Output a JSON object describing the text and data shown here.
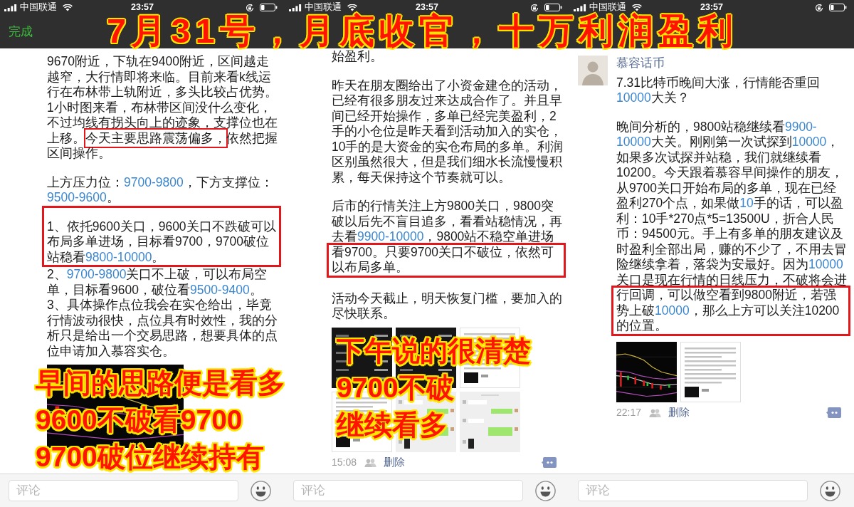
{
  "caption": "7月31号，月底收官，十万利润盈利",
  "panels": [
    {
      "status_bar": {
        "carrier": "中国联通",
        "time": "23:57"
      },
      "nav_bar": {
        "done": "完成"
      },
      "post": {
        "sections": [
          {
            "paragraphs": [
              {
                "boxed": false,
                "parts": [
                  {
                    "kind": "plain",
                    "text": "9670附近，下轨在9400附近，区间越走越窄，大行情即将来临。目前来看k线运行在布林带上轨附近，多头比较占优势。1小时图来看，布林带区间没什么变化，不过均线有拐头向上的迹象，支撑位也在上移。"
                  },
                  {
                    "kind": "marked",
                    "text": "今天主要思路震荡偏多，"
                  },
                  {
                    "kind": "plain",
                    "text": "依然把握区间操作。"
                  }
                ]
              }
            ]
          },
          {
            "paragraphs": [
              {
                "boxed": false,
                "parts": [
                  {
                    "kind": "plain",
                    "text": "上方压力位："
                  },
                  {
                    "kind": "number",
                    "text": "9700-9800"
                  },
                  {
                    "kind": "plain",
                    "text": "，下方支撑位："
                  },
                  {
                    "kind": "number",
                    "text": "9500-9600"
                  },
                  {
                    "kind": "plain",
                    "text": "。"
                  }
                ]
              }
            ]
          },
          {
            "paragraphs": [
              {
                "boxed": true,
                "parts": [
                  {
                    "kind": "plain",
                    "text": "1、依托9600关口，9600关口不跌破可以布局多单进场，目标看9700，9700破位站稳看"
                  },
                  {
                    "kind": "number",
                    "text": "9800-10000"
                  },
                  {
                    "kind": "plain",
                    "text": "。"
                  }
                ]
              },
              {
                "boxed": false,
                "parts": [
                  {
                    "kind": "plain",
                    "text": "2、"
                  },
                  {
                    "kind": "number",
                    "text": "9700-9800"
                  },
                  {
                    "kind": "plain",
                    "text": "关口不上破，可以布局空单，目标看9600，破位看"
                  },
                  {
                    "kind": "number",
                    "text": "9500-9400"
                  },
                  {
                    "kind": "plain",
                    "text": "。"
                  }
                ]
              },
              {
                "boxed": false,
                "parts": [
                  {
                    "kind": "plain",
                    "text": "3、具体操作点位我会在实仓给出，毕竟行情波动很快，点位具有时效性，我的分析只是给出一个交易思路，想要具体的点位申请加入慕容实仓。"
                  }
                ]
              }
            ]
          }
        ],
        "images": [
          {
            "kind": "chart"
          }
        ]
      },
      "overlay_caption": [
        "早间的思路便是看多",
        "9600不破看9700",
        "9700破位继续持有"
      ],
      "comment_bar": {
        "placeholder": "评论"
      }
    },
    {
      "status_bar": {
        "carrier": "中国联通",
        "time": "23:57"
      },
      "post": {
        "sections": [
          {
            "paragraphs": [
              {
                "boxed": false,
                "parts": [
                  {
                    "kind": "plain",
                    "text": "始盈利。"
                  }
                ]
              }
            ]
          },
          {
            "paragraphs": [
              {
                "boxed": false,
                "parts": [
                  {
                    "kind": "plain",
                    "text": "昨天在朋友圈给出了小资金建仓的活动，已经有很多朋友过来达成合作了。并且早间已经开始操作，多单已经完美盈利，2手的小仓位是昨天看到活动加入的实仓，10手的是大资金的实仓布局的多单。利润区别虽然很大，但是我们细水长流慢慢积累，每天保持这个节奏就可以。"
                  }
                ]
              }
            ]
          },
          {
            "paragraphs": [
              {
                "boxed": false,
                "parts": [
                  {
                    "kind": "plain",
                    "text": "后市的行情关注上方9800关口，9800突破以后先不盲目追多，看看站稳情况，再去看"
                  },
                  {
                    "kind": "number",
                    "text": "9900-10000"
                  },
                  {
                    "kind": "plain",
                    "text": "，9800站不稳空单进场"
                  }
                ]
              },
              {
                "boxed": true,
                "parts": [
                  {
                    "kind": "plain",
                    "text": "看9700。只要9700关口不破位，依然可以布局多单。"
                  }
                ]
              }
            ]
          },
          {
            "paragraphs": [
              {
                "boxed": false,
                "parts": [
                  {
                    "kind": "plain",
                    "text": "活动今天截止，明天恢复门槛，要加入的尽快联系。"
                  }
                ]
              }
            ]
          }
        ],
        "images": [
          {
            "kind": "dark"
          },
          {
            "kind": "dark"
          },
          {
            "kind": "text"
          },
          {
            "kind": "text"
          },
          {
            "kind": "chat"
          },
          {
            "kind": "chat"
          }
        ],
        "footer": {
          "time": "15:08",
          "delete": "删除"
        }
      },
      "overlay_caption": [
        "下午说的很清楚",
        "9700不破",
        "继续看多"
      ],
      "comment_bar": {
        "placeholder": "评论"
      }
    },
    {
      "status_bar": {
        "carrier": "中国联通",
        "time": "23:57"
      },
      "post": {
        "author": {
          "name": "慕容话币"
        },
        "sections": [
          {
            "paragraphs": [
              {
                "boxed": false,
                "parts": [
                  {
                    "kind": "plain",
                    "text": "7.31比特币晚间大涨，行情能否重回"
                  },
                  {
                    "kind": "number",
                    "text": "10000"
                  },
                  {
                    "kind": "plain",
                    "text": "大关？"
                  }
                ]
              }
            ]
          },
          {
            "paragraphs": [
              {
                "boxed": false,
                "parts": [
                  {
                    "kind": "plain",
                    "text": "晚间分析的，9800站稳继续看"
                  },
                  {
                    "kind": "number",
                    "text": "9900-10000"
                  },
                  {
                    "kind": "plain",
                    "text": "大关。刚刚第一次试探到"
                  },
                  {
                    "kind": "number",
                    "text": "10000"
                  },
                  {
                    "kind": "plain",
                    "text": "，如果多次试探并站稳，我们就继续看10200。今天跟着慕容早间操作的朋友，从9700关口开始布局的多单，现在已经盈利270个点，如果做"
                  },
                  {
                    "kind": "number",
                    "text": "10"
                  },
                  {
                    "kind": "plain",
                    "text": "手的话，可以盈利：10手*270点*5=13500U，折合人民币：94500元。手上有多单的朋友建议及时盈利全部出局，赚的不少了，不用去冒险继续拿着，落袋为安最好。因为"
                  },
                  {
                    "kind": "number",
                    "text": "10000"
                  },
                  {
                    "kind": "plain",
                    "text": "关口是现在行情的日线压力，不破将会进"
                  }
                ]
              },
              {
                "boxed": true,
                "parts": [
                  {
                    "kind": "plain",
                    "text": "行回调，可以做空看到9800附近，若强势上破"
                  },
                  {
                    "kind": "number",
                    "text": "10000"
                  },
                  {
                    "kind": "plain",
                    "text": "，那么上方可以关注10200的位置。"
                  }
                ]
              }
            ]
          }
        ],
        "images": [
          {
            "kind": "chart"
          },
          {
            "kind": "text"
          }
        ],
        "footer": {
          "time": "22:17",
          "delete": "删除"
        }
      },
      "comment_bar": {
        "placeholder": "评论"
      }
    }
  ]
}
